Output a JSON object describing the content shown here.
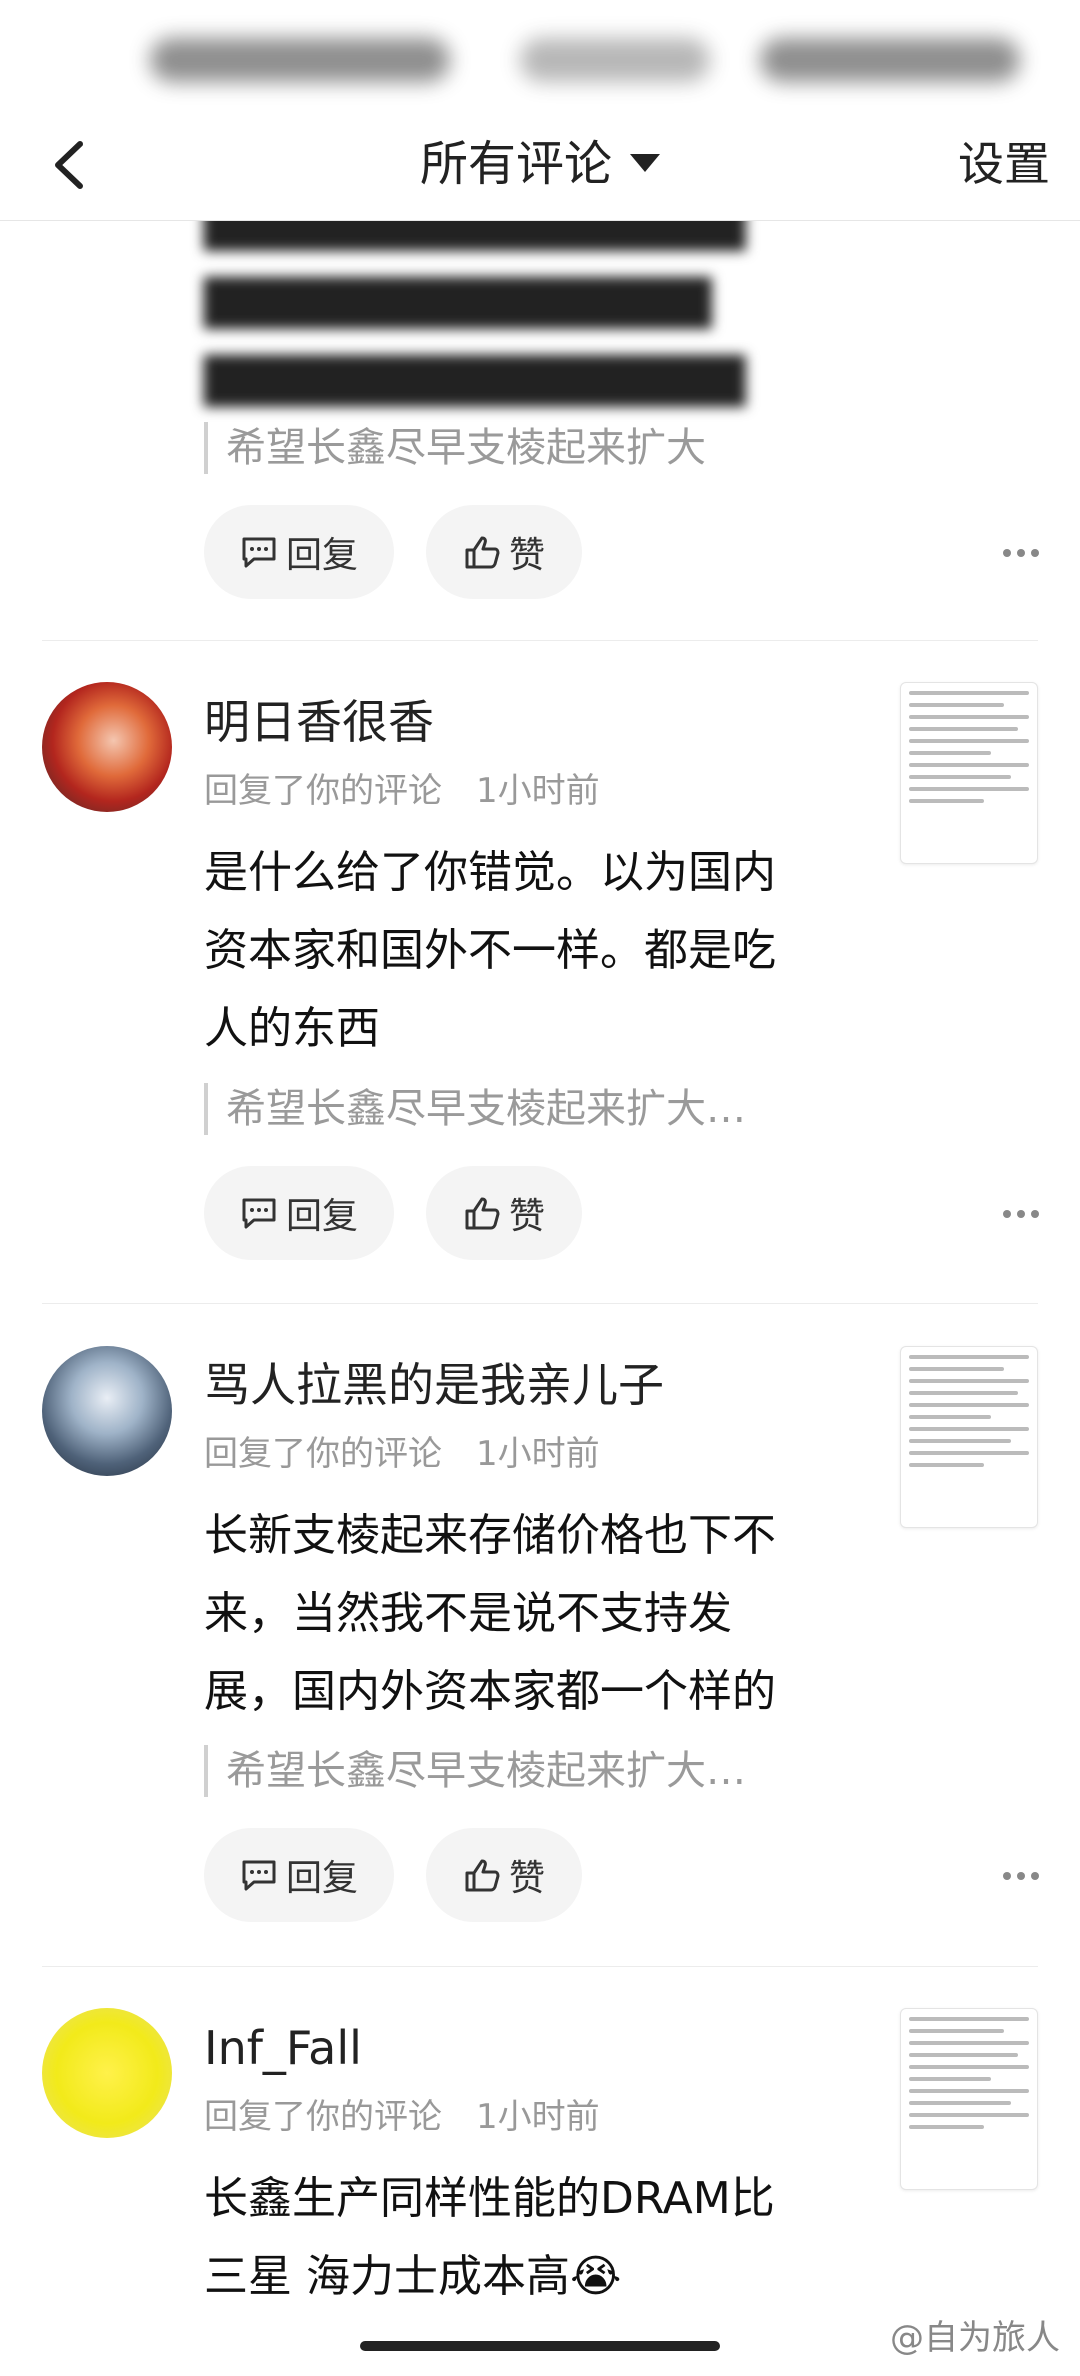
{
  "nav": {
    "title": "所有评论",
    "settings_label": "设置"
  },
  "actions": {
    "reply_label": "回复",
    "like_label": "赞"
  },
  "first_comment": {
    "quote": "希望长鑫尽早支棱起来扩大"
  },
  "comments": [
    {
      "username": "明日香很香",
      "meta_action": "回复了你的评论",
      "time": "1小时前",
      "lines": [
        "是什么给了你错觉。以为国内",
        "资本家和国外不一样。都是吃",
        "人的东西"
      ],
      "quote": "希望长鑫尽早支棱起来扩大…"
    },
    {
      "username": "骂人拉黑的是我亲儿子",
      "meta_action": "回复了你的评论",
      "time": "1小时前",
      "lines": [
        "长新支棱起来存储价格也下不",
        "来，当然我不是说不支持发",
        "展，国内外资本家都一个样的"
      ],
      "quote": "希望长鑫尽早支棱起来扩大…"
    },
    {
      "username": "Inf_Fall",
      "meta_action": "回复了你的评论",
      "time": "1小时前",
      "lines": [
        "长鑫生产同样性能的DRAM比",
        "三星 海力士成本高😭"
      ]
    }
  ],
  "watermark": "@自为旅人",
  "colors": {
    "text": "#111111",
    "secondary": "#999999",
    "pill_bg": "#f4f4f4",
    "avatar3": "#f2ea1a"
  }
}
